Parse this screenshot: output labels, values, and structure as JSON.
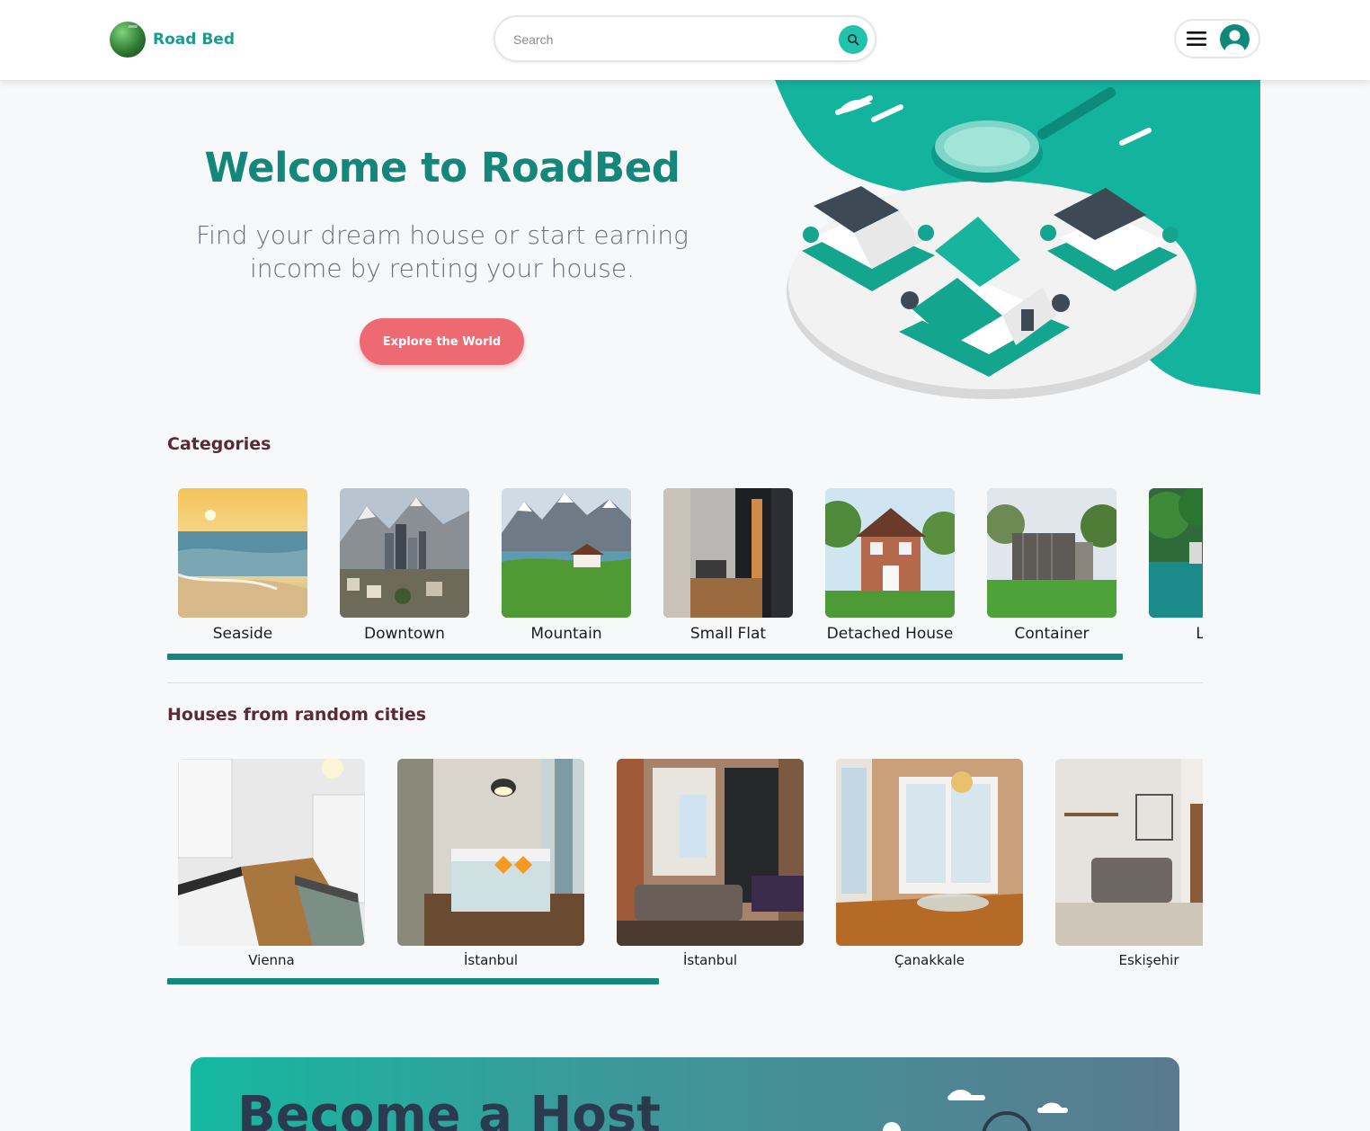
{
  "brand": {
    "name": "Road Bed"
  },
  "search": {
    "placeholder": "Search"
  },
  "hero": {
    "title": "Welcome to RoadBed",
    "subtitle_line1": "Find your dream house or start earning",
    "subtitle_line2": "income by renting your house.",
    "cta_label": "Explore the World"
  },
  "categories": {
    "title": "Categories",
    "items": [
      {
        "label": "Seaside"
      },
      {
        "label": "Downtown"
      },
      {
        "label": "Mountain"
      },
      {
        "label": "Small Flat"
      },
      {
        "label": "Detached House"
      },
      {
        "label": "Container"
      },
      {
        "label": "Lake"
      }
    ],
    "scroll_progress": 0.92
  },
  "houses": {
    "title": "Houses from random cities",
    "items": [
      {
        "city": "Vienna"
      },
      {
        "city": "İstanbul"
      },
      {
        "city": "İstanbul"
      },
      {
        "city": "Çanakkale"
      },
      {
        "city": "Eskişehir"
      }
    ],
    "scroll_progress": 0.475
  },
  "host": {
    "title": "Become a Host"
  },
  "colors": {
    "brand": "#1a9c8c",
    "accent": "#23c2aa",
    "cta": "#ee6a73",
    "section_title": "#5a2a35",
    "scrollbar": "#15887c"
  },
  "icons": {
    "search": "search-icon",
    "menu": "hamburger-menu-icon",
    "user": "user-avatar-icon"
  }
}
